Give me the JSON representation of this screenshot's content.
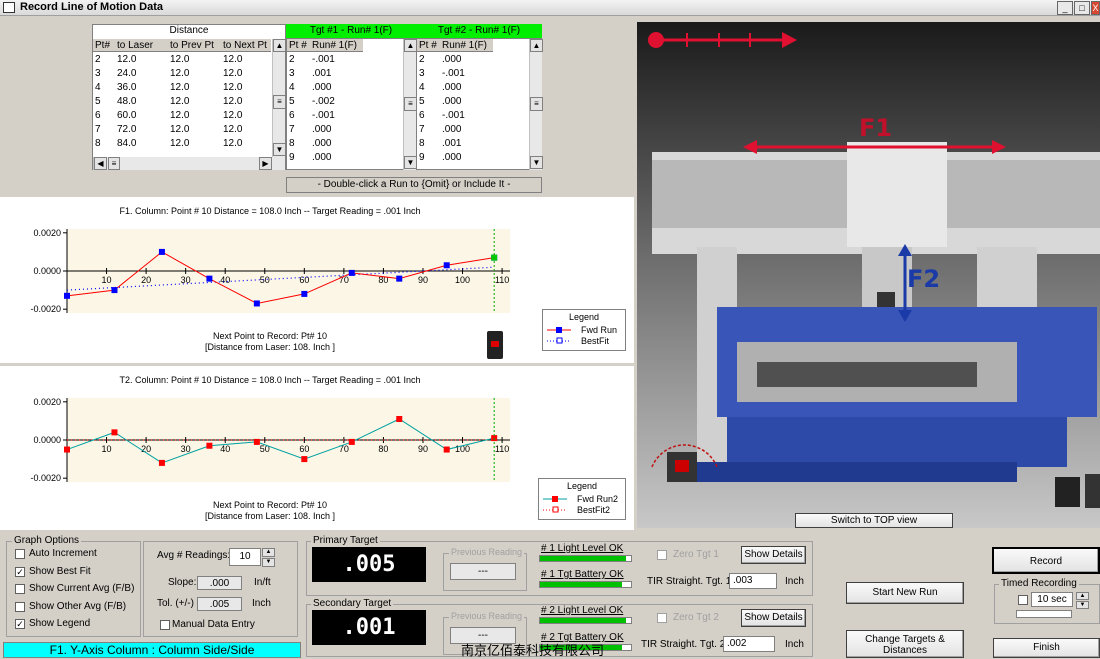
{
  "window": {
    "title": "Record Line of Motion Data",
    "min": "_",
    "max": "□",
    "close": "X"
  },
  "distance_table": {
    "group_header": "Distance",
    "columns": [
      "Pt#",
      "to Laser",
      "to Prev Pt",
      "to Next Pt"
    ],
    "rows": [
      [
        "2",
        "12.0",
        "12.0",
        "12.0"
      ],
      [
        "3",
        "24.0",
        "12.0",
        "12.0"
      ],
      [
        "4",
        "36.0",
        "12.0",
        "12.0"
      ],
      [
        "5",
        "48.0",
        "12.0",
        "12.0"
      ],
      [
        "6",
        "60.0",
        "12.0",
        "12.0"
      ],
      [
        "7",
        "72.0",
        "12.0",
        "12.0"
      ],
      [
        "8",
        "84.0",
        "12.0",
        "12.0"
      ]
    ]
  },
  "tgt1_table": {
    "header": "Tgt #1 - Run# 1(F)",
    "columns": [
      "Pt #",
      "Run# 1(F)"
    ],
    "rows": [
      [
        "2",
        "-.001"
      ],
      [
        "3",
        ".001"
      ],
      [
        "4",
        ".000"
      ],
      [
        "5",
        "-.002"
      ],
      [
        "6",
        "-.001"
      ],
      [
        "7",
        ".000"
      ],
      [
        "8",
        ".000"
      ],
      [
        "9",
        ".000"
      ]
    ]
  },
  "tgt2_table": {
    "header": "Tgt #2 - Run# 1(F)",
    "columns": [
      "Pt #",
      "Run# 1(F)"
    ],
    "rows": [
      [
        "2",
        ".000"
      ],
      [
        "3",
        "-.001"
      ],
      [
        "4",
        ".000"
      ],
      [
        "5",
        ".000"
      ],
      [
        "6",
        "-.001"
      ],
      [
        "7",
        ".000"
      ],
      [
        "8",
        ".001"
      ],
      [
        "9",
        ".000"
      ]
    ]
  },
  "table_hint": "- Double-click a Run to {Omit} or Include It -",
  "chart_f1": {
    "title": "F1. Column: Point # 10 Distance = 108.0 Inch  -- Target Reading = .001 Inch",
    "next_point": "Next Point to Record: Pt# 10",
    "next_distance": "[Distance from Laser: 108. Inch ]",
    "legend": {
      "title": "Legend",
      "series1": "Fwd Run",
      "series2": "BestFit"
    }
  },
  "chart_f2": {
    "title": "T2. Column: Point # 10 Distance = 108.0 Inch  -- Target Reading = .001 Inch",
    "next_point": "Next Point to Record: Pt# 10",
    "next_distance": "[Distance from Laser: 108. Inch ]",
    "legend": {
      "title": "Legend",
      "series1": "Fwd Run2",
      "series2": "BestFit2"
    }
  },
  "chart_data": [
    {
      "type": "line",
      "title": "F1. Column: Point # 10 Distance = 108.0 Inch  -- Target Reading = .001 Inch",
      "x_ticks": [
        "10",
        "20",
        "30",
        "40",
        "50",
        "60",
        "70",
        "80",
        "90",
        "100",
        "110"
      ],
      "y_ticks": [
        "0.0020",
        "0.0000",
        "-0.0020"
      ],
      "ylim": [
        -0.0022,
        0.0022
      ],
      "xlim": [
        0,
        112
      ],
      "series": [
        {
          "name": "Fwd Run",
          "color": "#ff0000",
          "marker_color": "#0000ff",
          "x": [
            0,
            12,
            24,
            36,
            48,
            60,
            72,
            84,
            96,
            108
          ],
          "y": [
            -0.0013,
            -0.001,
            0.001,
            -0.0004,
            -0.0017,
            -0.0012,
            -0.0001,
            -0.0004,
            0.0003,
            0.0007
          ]
        },
        {
          "name": "BestFit",
          "color": "#0000ff",
          "x": [
            0,
            108
          ],
          "y": [
            -0.001,
            0.0002
          ]
        }
      ],
      "current_point": {
        "x": 108,
        "y": 0.0007,
        "color": "#00cc00"
      }
    },
    {
      "type": "line",
      "title": "T2. Column: Point # 10 Distance = 108.0 Inch  -- Target Reading = .001 Inch",
      "x_ticks": [
        "10",
        "20",
        "30",
        "40",
        "50",
        "60",
        "70",
        "80",
        "90",
        "100",
        "110"
      ],
      "y_ticks": [
        "0.0020",
        "0.0000",
        "-0.0020"
      ],
      "ylim": [
        -0.0022,
        0.0022
      ],
      "xlim": [
        0,
        112
      ],
      "series": [
        {
          "name": "Fwd Run2",
          "color": "#00a0a0",
          "marker_color": "#ff0000",
          "x": [
            0,
            12,
            24,
            36,
            48,
            60,
            72,
            84,
            96,
            108
          ],
          "y": [
            -0.0005,
            0.0004,
            -0.0012,
            -0.0003,
            -0.0001,
            -0.001,
            -0.0001,
            0.0011,
            -0.0005,
            0.0001
          ]
        },
        {
          "name": "BestFit2",
          "color": "#ff0000",
          "x": [
            0,
            108
          ],
          "y": [
            0.0,
            0.0
          ]
        }
      ]
    }
  ],
  "image_panel": {
    "f1_label": "F1",
    "f2_label": "F2",
    "switch_button": "Switch to TOP view"
  },
  "graph_options": {
    "title": "Graph Options",
    "items": [
      {
        "label": "Auto Increment",
        "checked": false
      },
      {
        "label": "Show Best Fit",
        "checked": true
      },
      {
        "label": "Show Current Avg (F/B)",
        "checked": false
      },
      {
        "label": "Show Other Avg (F/B)",
        "checked": false
      },
      {
        "label": "Show Legend",
        "checked": true
      }
    ]
  },
  "readings": {
    "avg_label": "Avg # Readings:",
    "avg_value": "10",
    "slope_label": "Slope:",
    "slope_value": ".000",
    "slope_unit": "In/ft",
    "tol_label": "Tol. (+/-)",
    "tol_value": ".005",
    "tol_unit": "Inch",
    "manual_label": "Manual Data Entry"
  },
  "axis_status": "F1. Y-Axis Column : Column Side/Side",
  "primary": {
    "title": "Primary Target",
    "value": ".005",
    "prev_label": "Previous Reading",
    "prev_value": "---",
    "light_label": "# 1 Light Level OK",
    "light_level": 0.95,
    "battery_label": "# 1 Tgt Battery OK",
    "battery_level": 0.9,
    "zero_label": "Zero Tgt 1",
    "details": "Show Details",
    "tir_label": "TIR Straight. Tgt. 1:",
    "tir_value": ".003",
    "tir_unit": "Inch"
  },
  "secondary": {
    "title": "Secondary Target",
    "value": ".001",
    "prev_label": "Previous Reading",
    "prev_value": "---",
    "light_label": "# 2 Light Level OK",
    "light_level": 0.95,
    "battery_label": "# 2 Tgt Battery OK",
    "battery_level": 0.9,
    "zero_label": "Zero Tgt 2",
    "details": "Show Details",
    "tir_label": "TIR Straight. Tgt. 2:",
    "tir_value": ".002",
    "tir_unit": "Inch"
  },
  "actions": {
    "start_new_run": "Start New Run",
    "change_targets_1": "Change Targets  &",
    "change_targets_2": "Distances",
    "record": "Record",
    "timed_title": "Timed Recording",
    "timed_value": "10 sec",
    "finish": "Finish"
  },
  "watermark": "南京亿佰泰科技有限公司"
}
